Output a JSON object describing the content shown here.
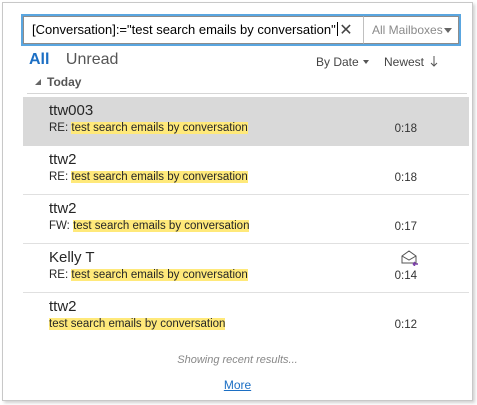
{
  "search": {
    "value": "[Conversation]:=\"test search emails by conversation\"",
    "clear_symbol": "✕",
    "scope": "All Mailboxes"
  },
  "tabs": {
    "all": "All",
    "unread": "Unread"
  },
  "sort": {
    "by": "By Date",
    "order": "Newest"
  },
  "group": {
    "label": "Today"
  },
  "items": [
    {
      "sender": "ttw003",
      "prefix": "RE: ",
      "subject": "test search emails by conversation",
      "time": "0:18",
      "selected": true
    },
    {
      "sender": "ttw2",
      "prefix": "RE: ",
      "subject": "test search emails by conversation",
      "time": "0:18"
    },
    {
      "sender": "ttw2",
      "prefix": "FW: ",
      "subject": "test search emails by conversation",
      "time": "0:17"
    },
    {
      "sender": "Kelly T",
      "prefix": "RE: ",
      "subject": "test search emails by conversation",
      "time": "0:14",
      "icon": "envelope-reply-icon"
    },
    {
      "sender": "ttw2",
      "prefix": "",
      "subject": "test search emails by conversation",
      "time": "0:12"
    }
  ],
  "footer": {
    "note": "Showing recent results...",
    "more": "More"
  },
  "colors": {
    "accent": "#1c6fc4",
    "highlight": "#ffe97a",
    "selected": "#d9d9d9",
    "focus_border": "#5aa6e0"
  }
}
